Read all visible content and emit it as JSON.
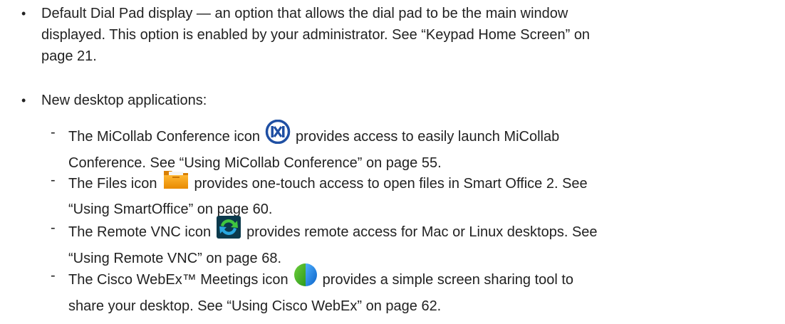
{
  "bullets": [
    {
      "symbol": "•",
      "line1": "Default Dial Pad display — an option that allows the dial pad to be the main window",
      "line2": "displayed. This option is enabled by your administrator. See “Keypad Home Screen” on",
      "line3": "page 21."
    },
    {
      "symbol": "•",
      "line1": "New desktop applications:"
    }
  ],
  "sub_items": [
    {
      "dash": "-",
      "before_icon": "The MiCollab Conference icon",
      "icon": "micollab-conference-icon",
      "after_icon": "provides access to easily launch MiCollab",
      "line2": "Conference. See “Using MiCollab Conference” on page 55."
    },
    {
      "dash": "-",
      "before_icon": "The Files icon",
      "icon": "files-folder-icon",
      "after_icon": "provides one-touch access to open files in Smart Office 2. See",
      "line2": "“Using SmartOffice” on page 60."
    },
    {
      "dash": "-",
      "before_icon": "The Remote VNC icon",
      "icon": "remote-vnc-icon",
      "after_icon": "provides remote access for Mac or Linux desktops. See",
      "line2": "“Using Remote VNC” on page 68."
    },
    {
      "dash": "-",
      "before_icon": "The Cisco WebEx™ Meetings icon",
      "icon": "cisco-webex-meetings-icon",
      "after_icon": "provides a simple screen sharing tool to",
      "line2": "share your desktop. See “Using Cisco WebEx” on page 62."
    }
  ]
}
